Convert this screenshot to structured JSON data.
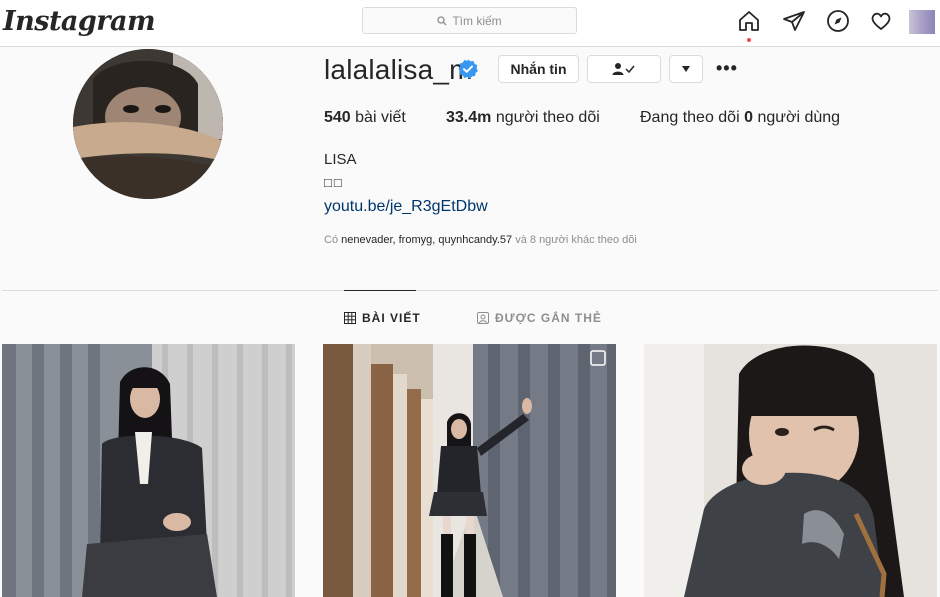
{
  "app": {
    "logo": "Instagram"
  },
  "search": {
    "placeholder": "Tìm kiếm"
  },
  "profile": {
    "username": "lalalalisa_m",
    "message_button": "Nhắn tin",
    "posts_count": "540",
    "posts_label": "bài viết",
    "followers_count": "33.4m",
    "followers_label": "người theo dõi",
    "following_prefix": "Đang theo dõi",
    "following_count": "0",
    "following_suffix": "người dùng",
    "full_name": "LISA",
    "bio_line": "□□",
    "link": "youtu.be/je_R3gEtDbw",
    "followed_by_prefix": "Có",
    "followed_by_names": "nenevader, fromyg, quynhcandy.57",
    "followed_by_suffix": "và 8 người khác theo dõi"
  },
  "tabs": [
    {
      "label": "BÀI VIẾT",
      "active": true
    },
    {
      "label": "ĐƯỢC GẮN THẺ",
      "active": false
    }
  ],
  "colors": {
    "verified": "#3897f0",
    "link": "#00376b",
    "notification_dot": "#ed4956"
  }
}
